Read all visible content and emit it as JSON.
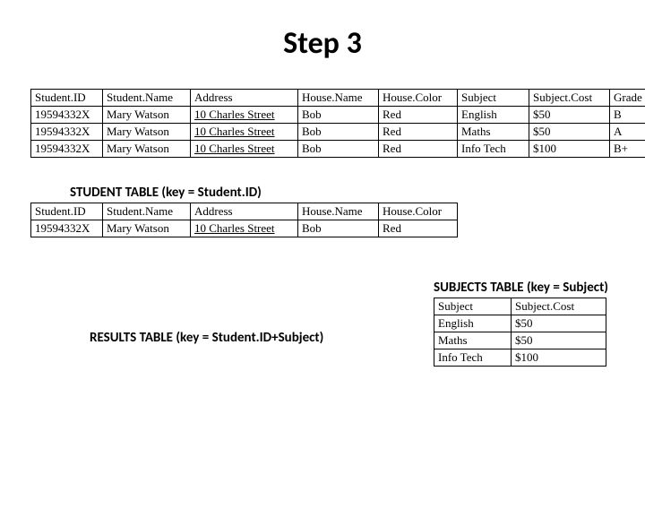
{
  "title": "Step 3",
  "captions": {
    "student": "STUDENT TABLE (key = Student.ID)",
    "subjects": "SUBJECTS TABLE (key = Subject)",
    "results": "RESULTS TABLE (key = Student.ID+Subject)"
  },
  "mainTable": {
    "headers": [
      "Student.ID",
      "Student.Name",
      "Address",
      "House.Name",
      "House.Color",
      "Subject",
      "Subject.Cost",
      "Grade"
    ],
    "rows": [
      [
        "19594332X",
        "Mary Watson",
        "10 Charles Street",
        "Bob",
        "Red",
        "English",
        "$50",
        "B"
      ],
      [
        "19594332X",
        "Mary Watson",
        "10 Charles Street",
        "Bob",
        "Red",
        "Maths",
        "$50",
        "A"
      ],
      [
        "19594332X",
        "Mary Watson",
        "10 Charles Street",
        "Bob",
        "Red",
        "Info Tech",
        "$100",
        "B+"
      ]
    ]
  },
  "studentTable": {
    "headers": [
      "Student.ID",
      "Student.Name",
      "Address",
      "House.Name",
      "House.Color"
    ],
    "rows": [
      [
        "19594332X",
        "Mary Watson",
        "10 Charles Street",
        "Bob",
        "Red"
      ]
    ]
  },
  "subjectsTable": {
    "headers": [
      "Subject",
      "Subject.Cost"
    ],
    "rows": [
      [
        "English",
        "$50"
      ],
      [
        "Maths",
        "$50"
      ],
      [
        "Info Tech",
        "$100"
      ]
    ]
  },
  "colWidths": {
    "main": [
      70,
      88,
      110,
      80,
      78,
      70,
      80,
      52
    ],
    "student": [
      70,
      88,
      110,
      80,
      78
    ],
    "subjects": [
      76,
      96
    ]
  }
}
